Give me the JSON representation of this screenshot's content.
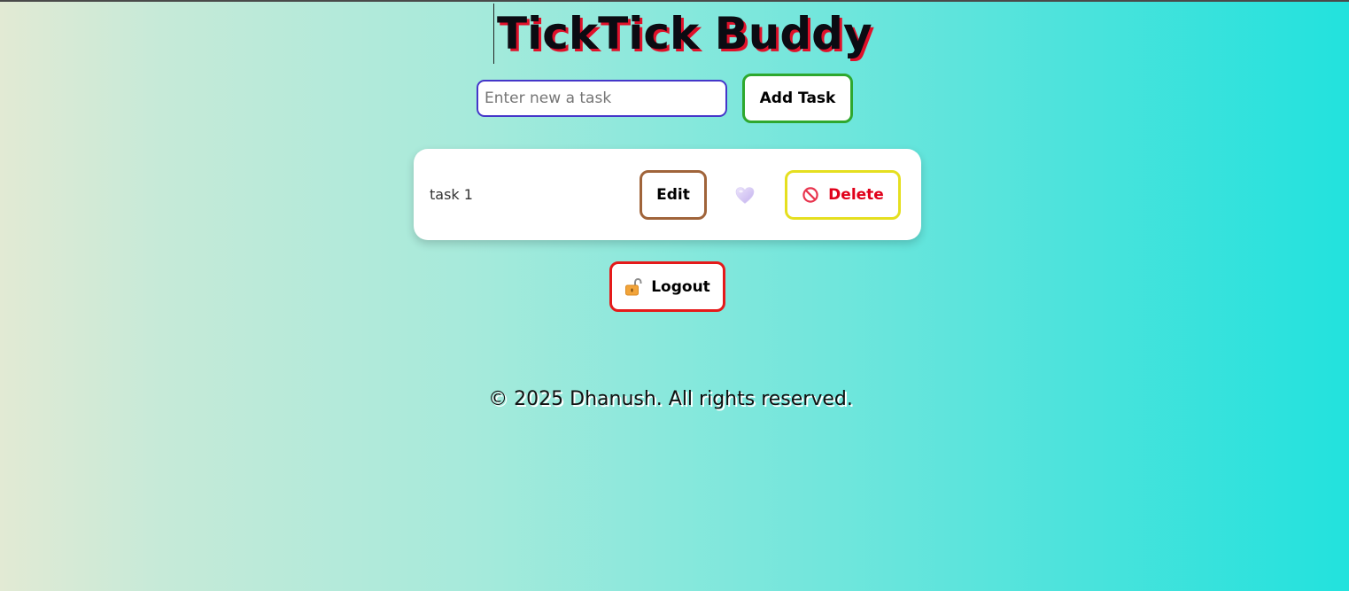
{
  "app": {
    "title": "TickTick Buddy"
  },
  "task_form": {
    "input_value": "",
    "input_placeholder": "Enter new a task",
    "add_label": "Add Task"
  },
  "tasks": [
    {
      "text": "task 1",
      "edit_label": "Edit",
      "favorite_icon": "heart-icon",
      "delete_label": "Delete",
      "delete_icon": "prohibited-icon"
    }
  ],
  "logout": {
    "label": "Logout",
    "icon": "unlocked-padlock-icon"
  },
  "footer": {
    "text": "© 2025 Dhanush. All rights reserved."
  },
  "colors": {
    "title_shadow": "#e0102a",
    "input_border": "#4436c9",
    "add_border": "#2ea82e",
    "edit_border": "#a0643a",
    "delete_border": "#e5df1f",
    "delete_text": "#e0001a",
    "logout_border": "#e51a1a",
    "gradient_start": "#e2ead4",
    "gradient_end": "#22e2dd"
  }
}
